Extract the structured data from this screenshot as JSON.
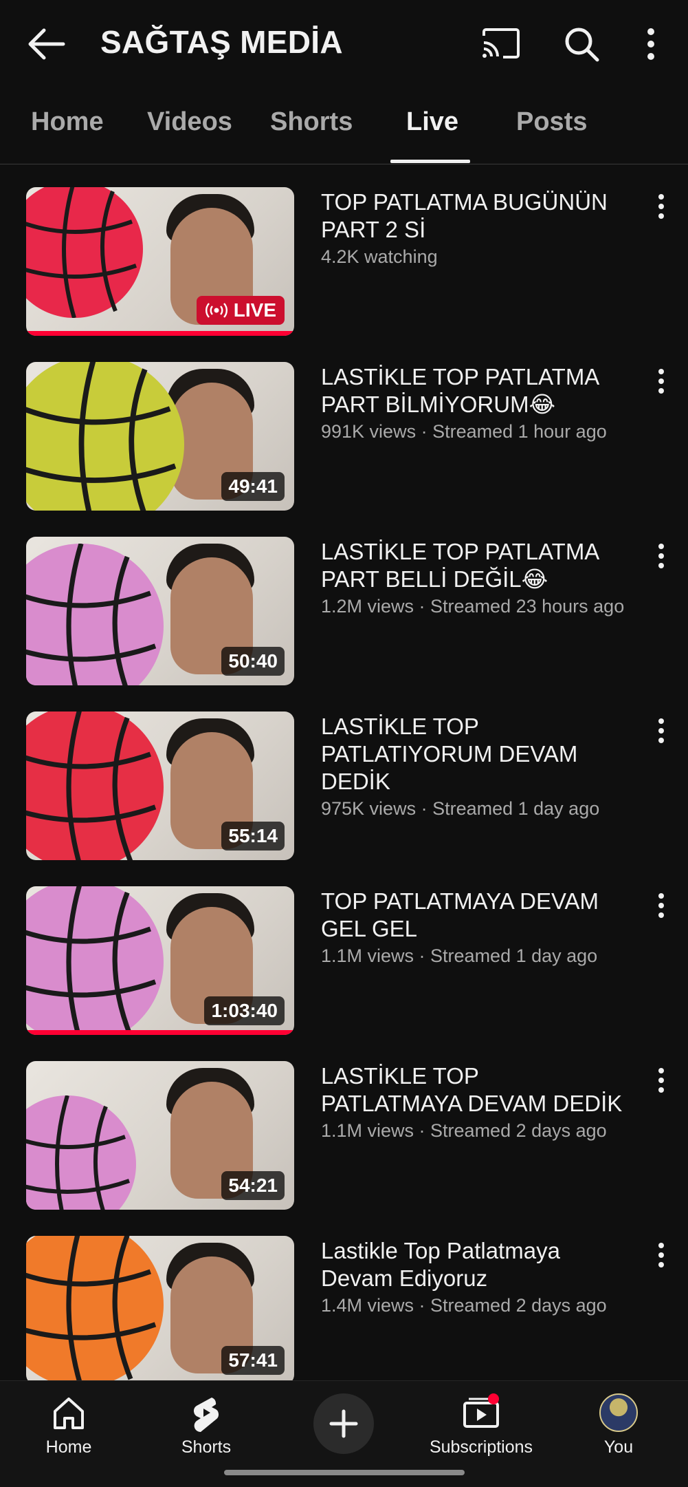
{
  "header": {
    "title": "SAĞTAŞ MEDİA"
  },
  "tabs": [
    {
      "label": "Home"
    },
    {
      "label": "Videos"
    },
    {
      "label": "Shorts"
    },
    {
      "label": "Live"
    },
    {
      "label": "Posts"
    }
  ],
  "active_tab": "Live",
  "videos": [
    {
      "title": "TOP PATLATMA BUGÜNÜN PART 2 Sİ",
      "meta": "4.2K watching",
      "badge": "LIVE",
      "watched": 1.0,
      "ball_color": "#e8284a"
    },
    {
      "title": "LASTİKLE TOP PATLATMA PART BİLMİYORUM😂",
      "meta": "991K views · Streamed 1 hour ago",
      "duration": "49:41",
      "watched": 0,
      "ball_color": "#c8cc3a"
    },
    {
      "title": "LASTİKLE TOP PATLATMA PART BELLİ DEĞİL😂",
      "meta": "1.2M views · Streamed 23 hours ago",
      "duration": "50:40",
      "watched": 0,
      "ball_color": "#d98ccd"
    },
    {
      "title": "LASTİKLE TOP PATLATIYORUM DEVAM DEDİK",
      "meta": "975K views · Streamed 1 day ago",
      "duration": "55:14",
      "watched": 0,
      "ball_color": "#e62f45"
    },
    {
      "title": "TOP PATLATMAYA DEVAM GEL GEL",
      "meta": "1.1M views · Streamed 1 day ago",
      "duration": "1:03:40",
      "watched": 1.0,
      "ball_color": "#d98ccd"
    },
    {
      "title": "LASTİKLE TOP PATLATMAYA DEVAM DEDİK",
      "meta": "1.1M views · Streamed 2 days ago",
      "duration": "54:21",
      "watched": 0,
      "ball_color": "#d98ccd"
    },
    {
      "title": "Lastikle Top Patlatmaya Devam Ediyoruz",
      "meta": "1.4M views · Streamed 2 days ago",
      "duration": "57:41",
      "watched": 0,
      "ball_color": "#f07a2a"
    }
  ],
  "bottom_nav": {
    "home": "Home",
    "shorts": "Shorts",
    "subscriptions": "Subscriptions",
    "you": "You"
  },
  "colors": {
    "accent": "#ff0033",
    "live_badge": "#cc0f2e",
    "background": "#0f0f0f"
  }
}
